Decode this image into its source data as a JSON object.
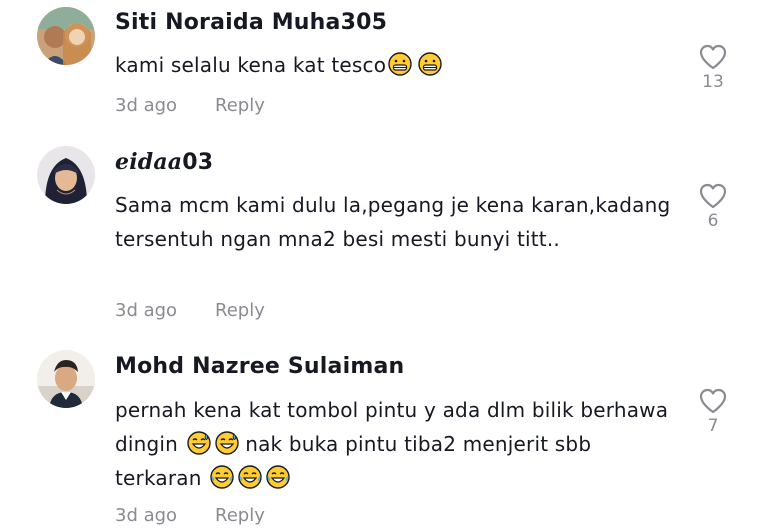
{
  "comments": [
    {
      "username": "Siti Noraida Muha305",
      "text_parts": [
        "kami selalu kena kat tesco"
      ],
      "emojis": [
        "grin-emoji",
        "grin-emoji"
      ],
      "time": "3d ago",
      "reply_label": "Reply",
      "like_count": "13"
    },
    {
      "username_script": "eidaa",
      "username_rest": "03",
      "text": "Sama mcm kami dulu la,pegang je kena karan,kadang tersentuh ngan mna2 besi mesti bunyi titt..",
      "time": "3d ago",
      "reply_label": "Reply",
      "like_count": "6"
    },
    {
      "username": "Mohd Nazree Sulaiman",
      "text_part1": "pernah kena kat tombol pintu y ada dlm bilik berhawa dingin",
      "text_part2": "nak buka pintu tiba2 menjerit sbb terkaran",
      "time": "3d ago",
      "reply_label": "Reply",
      "like_count": "7"
    }
  ],
  "icons": {
    "like": "heart-outline-icon",
    "emoji_1": "grinning-face-emoji",
    "emoji_2": "grinning-sweat-emoji",
    "emoji_3": "tears-of-joy-emoji"
  },
  "colors": {
    "text_primary": "#161823",
    "text_secondary": "#8a8b91",
    "emoji_yellow": "#ffcc33"
  }
}
